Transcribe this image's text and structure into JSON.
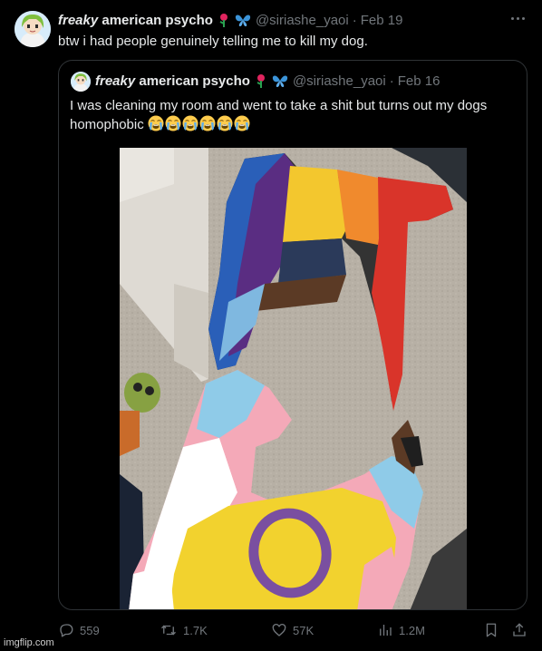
{
  "post": {
    "author_name_italic": "freaky",
    "author_name_rest": " american psycho",
    "handle": "@siriashe_yaoi",
    "date": "Feb 19",
    "text": "btw i had people genuinely telling me to kill my dog.",
    "icons": [
      "rose-icon",
      "butterfly-icon"
    ]
  },
  "quote": {
    "author_name_italic": "freaky",
    "author_name_rest": " american psycho",
    "handle": "@siriashe_yaoi",
    "date": "Feb 16",
    "text_line1": "I was cleaning my room and went to take a shit but turns out my dogs",
    "text_line2": "homophobic",
    "sob_count": 6,
    "photo": "photo of a torn progress pride flag on a carpeted floor"
  },
  "actions": {
    "replies": "559",
    "reposts": "1.7K",
    "likes": "57K",
    "views": "1.2M"
  },
  "watermark": "imgflip.com",
  "colors": {
    "background": "#000000",
    "text": "#e7e9ea",
    "muted": "#71767b",
    "border": "#2f3336"
  }
}
